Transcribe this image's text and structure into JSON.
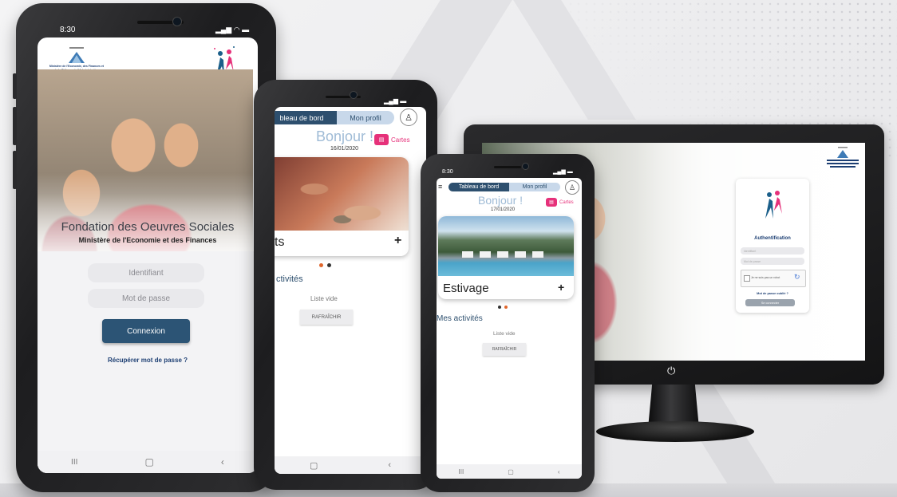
{
  "phone1": {
    "time": "8:30",
    "ministry_logo_text": "Ministère de l'Economie, des Finances et de la Réforme de l'Administration",
    "foundation_title": "Fondation des Oeuvres Sociales",
    "ministry_subtitle": "Ministère de l'Economie et des Finances",
    "username_placeholder": "Identifiant",
    "password_placeholder": "Mot de passe",
    "login_button": "Connexion",
    "forgot_password": "Récupérer mot de passe ?"
  },
  "phone2": {
    "tab_dashboard": "bleau de bord",
    "tab_profile": "Mon profil",
    "greeting": "Bonjour !",
    "date": "16/01/2020",
    "cards_label": "Cartes",
    "card_title": "ts",
    "activities_heading": "ctivités",
    "empty_list": "Liste vide",
    "refresh_button": "RAFRAÎCHIR"
  },
  "phone3": {
    "time": "8:30",
    "tab_dashboard": "Tableau de bord",
    "tab_profile": "Mon profil",
    "greeting": "Bonjour !",
    "date": "17/01/2020",
    "cards_label": "Cartes",
    "card_title": "Estivage",
    "activities_heading": "Mes activités",
    "empty_list": "Liste vide",
    "refresh_button": "RAFRAÎCHIR"
  },
  "monitor": {
    "auth_title": "Authentification",
    "recaptcha_label": "Je ne suis pas un robot",
    "forgot_password": "Mot de passe oublié ?",
    "login_button": "Se connecter",
    "username_placeholder": "Identifiant",
    "password_placeholder": "Mot de passe"
  },
  "colors": {
    "primary": "#2c5475",
    "accent_pink": "#e6317a",
    "greeting_blue": "#9fbbd6",
    "dot_orange": "#e0662c",
    "dot_dark": "#333333"
  },
  "icons": {
    "battery": "battery-icon",
    "wifi": "wifi-icon",
    "signal": "signal-icon",
    "recents": "recents-nav-icon",
    "home": "home-nav-icon",
    "back": "back-nav-icon",
    "power": "power-icon",
    "menu": "hamburger-menu-icon"
  }
}
